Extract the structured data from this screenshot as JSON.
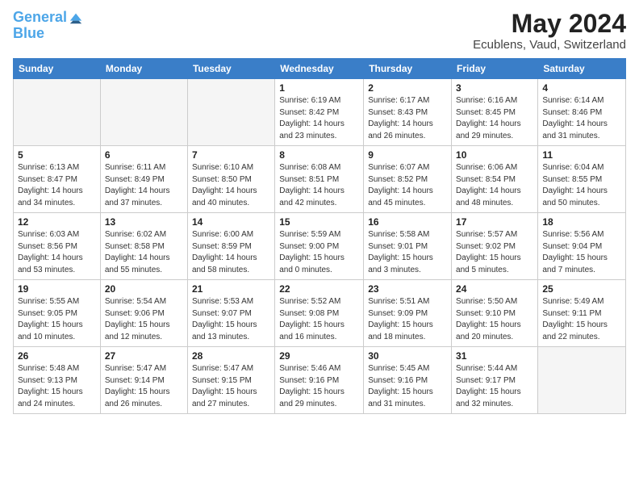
{
  "header": {
    "logo_line1": "General",
    "logo_line2": "Blue",
    "title": "May 2024",
    "subtitle": "Ecublens, Vaud, Switzerland"
  },
  "weekdays": [
    "Sunday",
    "Monday",
    "Tuesday",
    "Wednesday",
    "Thursday",
    "Friday",
    "Saturday"
  ],
  "weeks": [
    [
      {
        "day": "",
        "info": ""
      },
      {
        "day": "",
        "info": ""
      },
      {
        "day": "",
        "info": ""
      },
      {
        "day": "1",
        "info": "Sunrise: 6:19 AM\nSunset: 8:42 PM\nDaylight: 14 hours\nand 23 minutes."
      },
      {
        "day": "2",
        "info": "Sunrise: 6:17 AM\nSunset: 8:43 PM\nDaylight: 14 hours\nand 26 minutes."
      },
      {
        "day": "3",
        "info": "Sunrise: 6:16 AM\nSunset: 8:45 PM\nDaylight: 14 hours\nand 29 minutes."
      },
      {
        "day": "4",
        "info": "Sunrise: 6:14 AM\nSunset: 8:46 PM\nDaylight: 14 hours\nand 31 minutes."
      }
    ],
    [
      {
        "day": "5",
        "info": "Sunrise: 6:13 AM\nSunset: 8:47 PM\nDaylight: 14 hours\nand 34 minutes."
      },
      {
        "day": "6",
        "info": "Sunrise: 6:11 AM\nSunset: 8:49 PM\nDaylight: 14 hours\nand 37 minutes."
      },
      {
        "day": "7",
        "info": "Sunrise: 6:10 AM\nSunset: 8:50 PM\nDaylight: 14 hours\nand 40 minutes."
      },
      {
        "day": "8",
        "info": "Sunrise: 6:08 AM\nSunset: 8:51 PM\nDaylight: 14 hours\nand 42 minutes."
      },
      {
        "day": "9",
        "info": "Sunrise: 6:07 AM\nSunset: 8:52 PM\nDaylight: 14 hours\nand 45 minutes."
      },
      {
        "day": "10",
        "info": "Sunrise: 6:06 AM\nSunset: 8:54 PM\nDaylight: 14 hours\nand 48 minutes."
      },
      {
        "day": "11",
        "info": "Sunrise: 6:04 AM\nSunset: 8:55 PM\nDaylight: 14 hours\nand 50 minutes."
      }
    ],
    [
      {
        "day": "12",
        "info": "Sunrise: 6:03 AM\nSunset: 8:56 PM\nDaylight: 14 hours\nand 53 minutes."
      },
      {
        "day": "13",
        "info": "Sunrise: 6:02 AM\nSunset: 8:58 PM\nDaylight: 14 hours\nand 55 minutes."
      },
      {
        "day": "14",
        "info": "Sunrise: 6:00 AM\nSunset: 8:59 PM\nDaylight: 14 hours\nand 58 minutes."
      },
      {
        "day": "15",
        "info": "Sunrise: 5:59 AM\nSunset: 9:00 PM\nDaylight: 15 hours\nand 0 minutes."
      },
      {
        "day": "16",
        "info": "Sunrise: 5:58 AM\nSunset: 9:01 PM\nDaylight: 15 hours\nand 3 minutes."
      },
      {
        "day": "17",
        "info": "Sunrise: 5:57 AM\nSunset: 9:02 PM\nDaylight: 15 hours\nand 5 minutes."
      },
      {
        "day": "18",
        "info": "Sunrise: 5:56 AM\nSunset: 9:04 PM\nDaylight: 15 hours\nand 7 minutes."
      }
    ],
    [
      {
        "day": "19",
        "info": "Sunrise: 5:55 AM\nSunset: 9:05 PM\nDaylight: 15 hours\nand 10 minutes."
      },
      {
        "day": "20",
        "info": "Sunrise: 5:54 AM\nSunset: 9:06 PM\nDaylight: 15 hours\nand 12 minutes."
      },
      {
        "day": "21",
        "info": "Sunrise: 5:53 AM\nSunset: 9:07 PM\nDaylight: 15 hours\nand 13 minutes."
      },
      {
        "day": "22",
        "info": "Sunrise: 5:52 AM\nSunset: 9:08 PM\nDaylight: 15 hours\nand 16 minutes."
      },
      {
        "day": "23",
        "info": "Sunrise: 5:51 AM\nSunset: 9:09 PM\nDaylight: 15 hours\nand 18 minutes."
      },
      {
        "day": "24",
        "info": "Sunrise: 5:50 AM\nSunset: 9:10 PM\nDaylight: 15 hours\nand 20 minutes."
      },
      {
        "day": "25",
        "info": "Sunrise: 5:49 AM\nSunset: 9:11 PM\nDaylight: 15 hours\nand 22 minutes."
      }
    ],
    [
      {
        "day": "26",
        "info": "Sunrise: 5:48 AM\nSunset: 9:13 PM\nDaylight: 15 hours\nand 24 minutes."
      },
      {
        "day": "27",
        "info": "Sunrise: 5:47 AM\nSunset: 9:14 PM\nDaylight: 15 hours\nand 26 minutes."
      },
      {
        "day": "28",
        "info": "Sunrise: 5:47 AM\nSunset: 9:15 PM\nDaylight: 15 hours\nand 27 minutes."
      },
      {
        "day": "29",
        "info": "Sunrise: 5:46 AM\nSunset: 9:16 PM\nDaylight: 15 hours\nand 29 minutes."
      },
      {
        "day": "30",
        "info": "Sunrise: 5:45 AM\nSunset: 9:16 PM\nDaylight: 15 hours\nand 31 minutes."
      },
      {
        "day": "31",
        "info": "Sunrise: 5:44 AM\nSunset: 9:17 PM\nDaylight: 15 hours\nand 32 minutes."
      },
      {
        "day": "",
        "info": ""
      }
    ]
  ]
}
